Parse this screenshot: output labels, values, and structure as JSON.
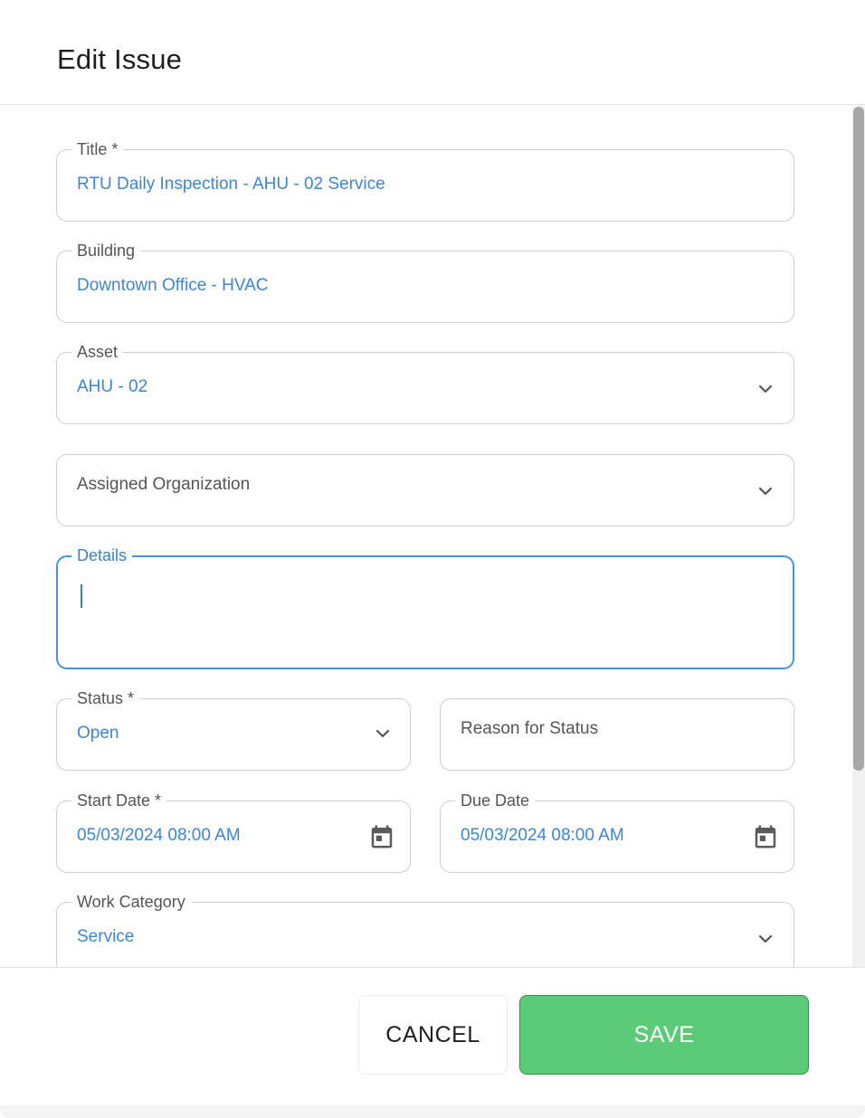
{
  "dialog": {
    "title": "Edit Issue"
  },
  "fields": {
    "title": {
      "label": "Title *",
      "value": "RTU Daily Inspection - AHU - 02 Service"
    },
    "building": {
      "label": "Building",
      "value": "Downtown Office - HVAC"
    },
    "asset": {
      "label": "Asset",
      "value": "AHU - 02"
    },
    "assigned_organization": {
      "placeholder": "Assigned Organization"
    },
    "details": {
      "label": "Details",
      "value": ""
    },
    "status": {
      "label": "Status *",
      "value": "Open"
    },
    "reason_for_status": {
      "placeholder": "Reason for Status"
    },
    "start_date": {
      "label": "Start Date *",
      "value": "05/03/2024 08:00 AM"
    },
    "due_date": {
      "label": "Due Date",
      "value": "05/03/2024 08:00 AM"
    },
    "work_category": {
      "label": "Work Category",
      "value": "Service"
    }
  },
  "footer": {
    "cancel_label": "CANCEL",
    "save_label": "SAVE"
  },
  "colors": {
    "accent": "#3b86d8",
    "save": "#5ccb78",
    "focus_border": "#4a90e2"
  }
}
